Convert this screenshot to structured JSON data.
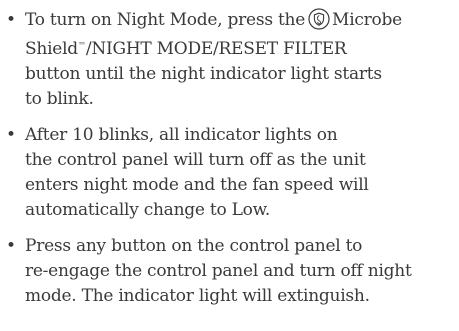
{
  "instructions": [
    {
      "line1_pre": "To turn on Night Mode, press the",
      "line1_post": "Microbe",
      "line2_pre": "Shield",
      "line2_tm": "™",
      "line2_post": "/NIGHT MODE/RESET FILTER",
      "line3": "button until the night indicator light starts",
      "line4": "to blink.",
      "icon": "microbe-shield-icon"
    },
    {
      "line1": "After 10 blinks, all indicator lights on",
      "line2": "the control panel will turn off as the unit",
      "line3": "enters night mode and the fan speed will",
      "line4": "automatically change to Low."
    },
    {
      "line1": "Press any button on the control panel to",
      "line2": "re-engage the control panel and turn off night",
      "line3": "mode. The indicator light will extinguish."
    }
  ],
  "bullet": "•",
  "colors": {
    "text": "#3a3a3a"
  }
}
